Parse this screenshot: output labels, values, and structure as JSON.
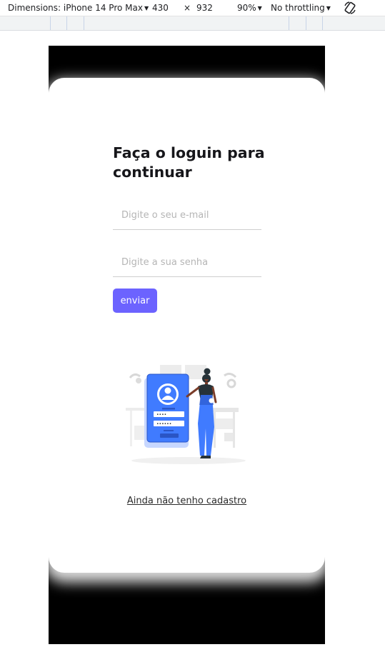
{
  "devtools": {
    "dimensions_label": "Dimensions: iPhone 14 Pro Max",
    "width": "430",
    "times": "×",
    "height": "932",
    "zoom": "90%",
    "throttling": "No throttling",
    "rotate_icon": "rotate-icon"
  },
  "login": {
    "title": "Faça o loguin para continuar",
    "email_placeholder": "Digite o seu e-mail",
    "password_placeholder": "Digite a sua senha",
    "submit_label": "enviar",
    "signup_link": "Ainda não tenho cadastro",
    "password_mask_1": "••••",
    "password_mask_2": "••••••"
  },
  "colors": {
    "accent": "#6c63ff",
    "illustration_blue": "#407bff",
    "viewport_bg": "#000000",
    "card_bg": "#ffffff"
  }
}
